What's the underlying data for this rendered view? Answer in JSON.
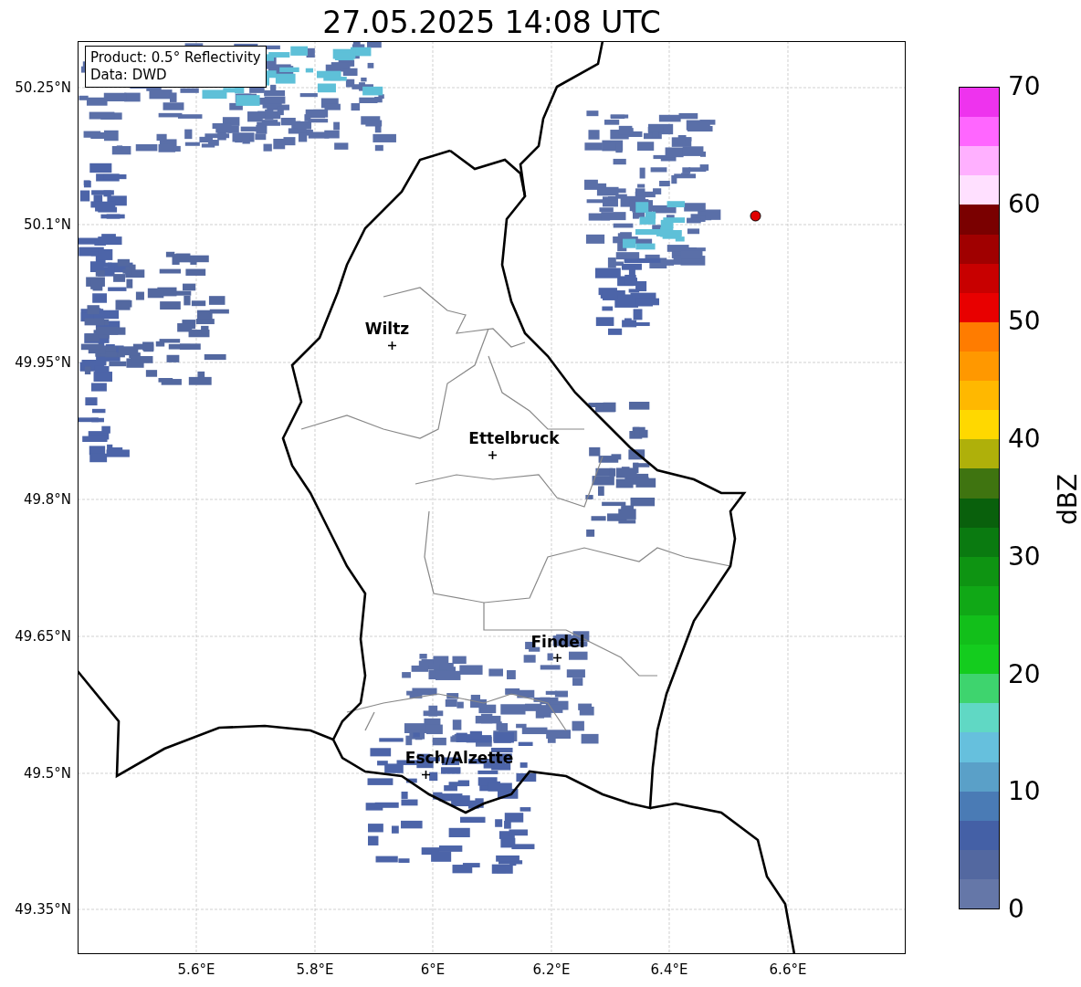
{
  "title": "27.05.2025 14:08 UTC",
  "info_box": {
    "lines": [
      "Product: 0.5° Reflectivity",
      "Data: DWD"
    ]
  },
  "lat_ticks": [
    "50.25°N",
    "50.1°N",
    "49.95°N",
    "49.8°N",
    "49.65°N",
    "49.5°N",
    "49.35°N"
  ],
  "lon_ticks": [
    "5.6°E",
    "5.8°E",
    "6°E",
    "6.2°E",
    "6.4°E",
    "6.6°E"
  ],
  "cities": [
    {
      "name": "Wiltz"
    },
    {
      "name": "Ettelbruck"
    },
    {
      "name": "Findel"
    },
    {
      "name": "Esch/Alzette"
    }
  ],
  "colorbar": {
    "label": "dBZ",
    "ticks": [
      "70",
      "60",
      "50",
      "40",
      "30",
      "20",
      "10",
      "0"
    ],
    "segments": [
      {
        "color": "#ee33ee"
      },
      {
        "color": "#ff66ff"
      },
      {
        "color": "#ffb0ff"
      },
      {
        "color": "#ffe0ff"
      },
      {
        "color": "#7a0000"
      },
      {
        "color": "#a00000"
      },
      {
        "color": "#c80000"
      },
      {
        "color": "#e80000"
      },
      {
        "color": "#ff7c00"
      },
      {
        "color": "#ff9800"
      },
      {
        "color": "#ffb800"
      },
      {
        "color": "#ffd800"
      },
      {
        "color": "#afb00a"
      },
      {
        "color": "#3f7410"
      },
      {
        "color": "#09600c"
      },
      {
        "color": "#0a7a10"
      },
      {
        "color": "#0e9412"
      },
      {
        "color": "#10a816"
      },
      {
        "color": "#12bf1a"
      },
      {
        "color": "#14cc1e"
      },
      {
        "color": "#3ed46e"
      },
      {
        "color": "#60d8c4"
      },
      {
        "color": "#66c0dd"
      },
      {
        "color": "#5aa0c8"
      },
      {
        "color": "#4a7bb5"
      },
      {
        "color": "#4460a6"
      },
      {
        "color": "#5368a0"
      },
      {
        "color": "#6577a8"
      }
    ]
  }
}
